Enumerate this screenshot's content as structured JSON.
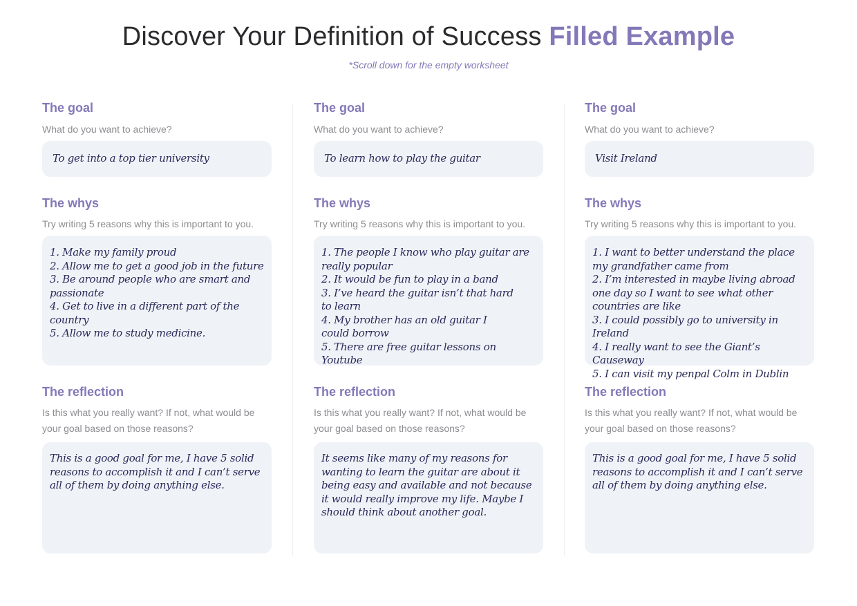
{
  "header": {
    "title": "Discover Your Definition of Success",
    "title_accent": "Filled Example",
    "subtitle": "*Scroll down for the empty worksheet"
  },
  "columns": [
    {
      "goal": {
        "title": "The goal",
        "prompt": "What do you want to achieve?",
        "answer": "To get into a top tier university"
      },
      "whys": {
        "title": "The whys",
        "prompt": "Try writing 5 reasons why this is important to you.",
        "answer": "1. Make my family proud\n2. Allow me to get a good job in the future\n3. Be around people who are smart and passionate\n4. Get to live in a different part of the country\n5. Allow me to study medicine."
      },
      "reflection": {
        "title": "The reflection",
        "prompt": "Is this what you really want? If not, what would be your goal based on those reasons?",
        "answer": "This is a good goal for me, I have 5 solid reasons to accomplish it and I can’t serve all of them by doing anything else."
      }
    },
    {
      "goal": {
        "title": "The goal",
        "prompt": "What do you want to achieve?",
        "answer": "To learn how to play the guitar"
      },
      "whys": {
        "title": "The whys",
        "prompt": "Try writing 5 reasons why this is important to you.",
        "answer": "1. The people I know who play guitar are really popular\n2. It would be fun to play in a band\n3. I’ve heard the guitar isn’t that hard\nto learn\n4. My brother has an old guitar I\ncould borrow\n5. There are free guitar lessons on Youtube"
      },
      "reflection": {
        "title": "The reflection",
        "prompt": "Is this what you really want? If not, what would be your goal based on those reasons?",
        "answer": "It seems like many of my reasons for wanting to learn the guitar are about it being easy and available and not because it would really improve my life. Maybe I should think about another goal."
      }
    },
    {
      "goal": {
        "title": "The goal",
        "prompt": "What do you want to achieve?",
        "answer": "Visit Ireland"
      },
      "whys": {
        "title": "The whys",
        "prompt": "Try writing 5 reasons why this is important to you.",
        "answer": "1. I want to better understand the place my grandfather came from\n2. I’m interested in maybe living abroad one day so I want to see what other countries are like\n3. I could possibly go to university in Ireland\n4. I really want to see the Giant’s Causeway\n5. I can visit my penpal Colm in Dublin"
      },
      "reflection": {
        "title": "The reflection",
        "prompt": "Is this what you really want? If not, what would be your goal based on those reasons?",
        "answer": "This is a good goal for me, I have 5 solid reasons to accomplish it and I can’t serve all of them by doing anything else."
      }
    }
  ]
}
